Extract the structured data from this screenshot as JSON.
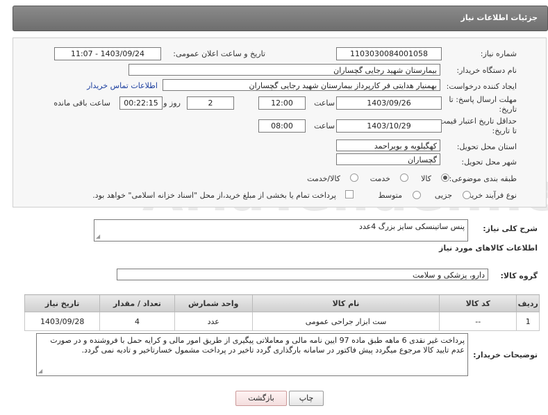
{
  "header": {
    "title": "جزئیات اطلاعات نیاز"
  },
  "form": {
    "need_number_label": "شماره نیاز:",
    "need_number": "1103030084001058",
    "announce_label": "تاریخ و ساعت اعلان عمومی:",
    "announce_value": "1403/09/24 - 11:07",
    "buyer_org_label": "نام دستگاه خریدار:",
    "buyer_org": "بیمارستان شهید رجایی گچساران",
    "creator_label": "ایجاد کننده درخواست:",
    "creator": "بهمنیار هدایتی فر کارپرداز بیمارستان شهید رجایی گچساران",
    "contact_link": "اطلاعات تماس خریدار",
    "deadline_label": "مهلت ارسال پاسخ: تا تاریخ:",
    "deadline_date": "1403/09/26",
    "time_label": "ساعت",
    "deadline_time": "12:00",
    "days_value": "2",
    "days_and_label": "روز و",
    "remaining_time": "00:22:15",
    "remaining_label": "ساعت باقی مانده",
    "min_validity_label": "حداقل تاریخ اعتبار قیمت: تا تاریخ:",
    "validity_date": "1403/10/29",
    "validity_time": "08:00",
    "province_label": "استان محل تحویل:",
    "province": "کهگیلویه و بویراحمد",
    "city_label": "شهر محل تحویل:",
    "city": "گچساران",
    "category_label": "طبقه بندی موضوعی:",
    "category_options": [
      "کالا",
      "خدمت",
      "کالا/خدمت"
    ],
    "category_selected": "کالا",
    "process_label": "نوع فرآیند خرید :",
    "process_options": [
      "جزیی",
      "متوسط"
    ],
    "process_note": "پرداخت تمام یا بخشی از مبلغ خرید،از محل \"اسناد خزانه اسلامی\" خواهد بود."
  },
  "summary": {
    "label": "شرح کلی نیاز:",
    "value": "پنس ساتینسکی سایز بزرگ   4عدد"
  },
  "goods_section": {
    "title": "اطلاعات کالاهای مورد نیاز",
    "group_label": "گروه کالا:",
    "group_value": "دارو، پزشکی و سلامت"
  },
  "table": {
    "headers": [
      "ردیف",
      "کد کالا",
      "نام کالا",
      "واحد شمارش",
      "تعداد / مقدار",
      "تاریخ نیاز"
    ],
    "rows": [
      [
        "1",
        "--",
        "ست ابزار جراحی عمومی",
        "عدد",
        "4",
        "1403/09/28"
      ]
    ]
  },
  "buyer_notes": {
    "label": "توضیحات خریدار:",
    "value": "پرداخت غیر نقدی 6 ماهه  طبق ماده 97 ایین نامه مالی و معاملاتی پیگیری از طریق امور مالی  و کرایه حمل با فروشنده و در صورت عدم تایید کالا مرجوع میگردد پیش فاکتور در سامانه بارگذاری گردد  تاخیر  در پرداخت مشمول خسارتاخیر و تادیه نمی گردد."
  },
  "buttons": {
    "print": "چاپ",
    "back": "بازگشت"
  },
  "watermark": "AriaTender.net"
}
